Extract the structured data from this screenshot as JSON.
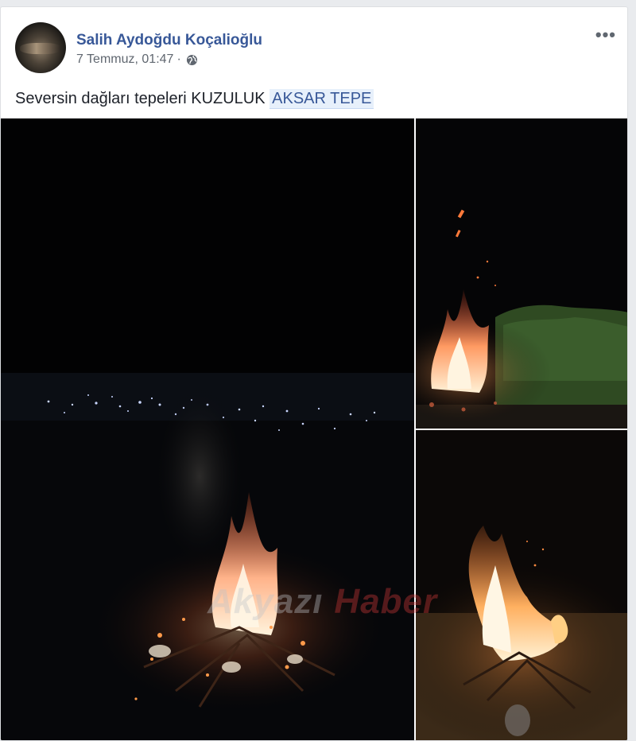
{
  "post": {
    "author_name": "Salih Aydoğdu Koçalioğlu",
    "timestamp": "7 Temmuz, 01:47",
    "separator": "·",
    "privacy_icon": "globe-icon",
    "more_icon": "more-options-icon",
    "more_label": "•••",
    "text": "Seversin dağları tepeleri KUZULUK",
    "tagged_place": "AKSAR TEPE"
  },
  "photos": [
    {
      "description_icon": "bonfire-city-lights-photo"
    },
    {
      "description_icon": "bonfire-sparks-photo"
    },
    {
      "description_icon": "bonfire-flames-photo"
    }
  ],
  "watermark": {
    "part1": "Akyazı",
    "part2": "Haber"
  },
  "colors": {
    "author": "#385898",
    "meta": "#606770",
    "text": "#1d2129",
    "background": "#e9ebee"
  }
}
